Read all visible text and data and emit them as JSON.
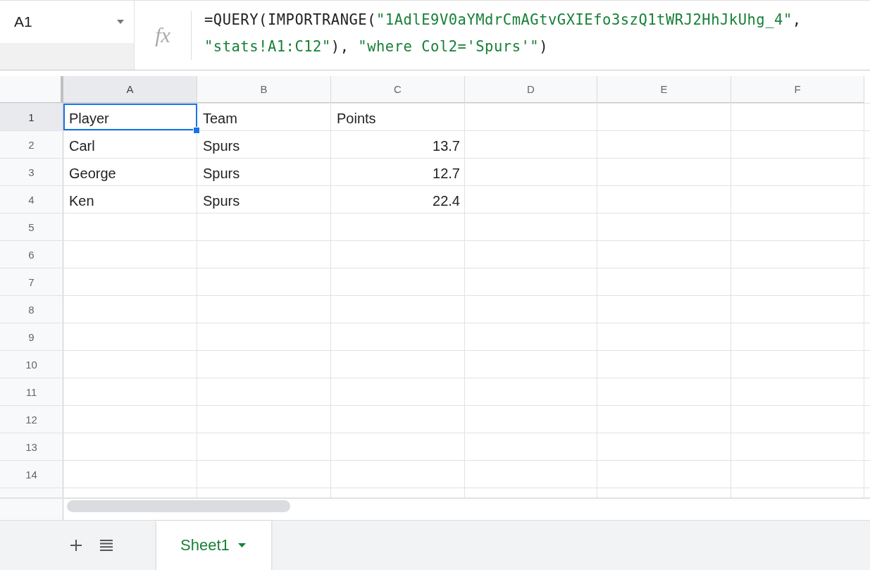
{
  "name_box": {
    "value": "A1"
  },
  "fx_label": "fx",
  "formula": {
    "lines": [
      [
        {
          "kind": "plain",
          "text": "=QUERY(IMPORTRANGE("
        },
        {
          "kind": "string",
          "text": "\"1AdlE9V0aYMdrCmAGtvGXIEfo3szQ1tWRJ2HhJkUhg_4\""
        },
        {
          "kind": "plain",
          "text": ","
        }
      ],
      [
        {
          "kind": "string",
          "text": "\"stats!A1:C12\""
        },
        {
          "kind": "plain",
          "text": "), "
        },
        {
          "kind": "string",
          "text": "\"where Col2='Spurs'\""
        },
        {
          "kind": "plain",
          "text": ")"
        }
      ]
    ]
  },
  "columns": [
    {
      "label": "A",
      "selected": true
    },
    {
      "label": "B",
      "selected": false
    },
    {
      "label": "C",
      "selected": false
    },
    {
      "label": "D",
      "selected": false
    },
    {
      "label": "E",
      "selected": false
    },
    {
      "label": "F",
      "selected": false
    }
  ],
  "rows": [
    {
      "number": "1",
      "selected": true,
      "cells": [
        {
          "text": "Player",
          "kind": "text",
          "selected": true
        },
        {
          "text": "Team",
          "kind": "text",
          "selected": false
        },
        {
          "text": "Points",
          "kind": "text",
          "selected": false
        }
      ]
    },
    {
      "number": "2",
      "selected": false,
      "cells": [
        {
          "text": "Carl",
          "kind": "text",
          "selected": false
        },
        {
          "text": "Spurs",
          "kind": "text",
          "selected": false
        },
        {
          "text": "13.7",
          "kind": "number",
          "selected": false
        }
      ]
    },
    {
      "number": "3",
      "selected": false,
      "cells": [
        {
          "text": "George",
          "kind": "text",
          "selected": false
        },
        {
          "text": "Spurs",
          "kind": "text",
          "selected": false
        },
        {
          "text": "12.7",
          "kind": "number",
          "selected": false
        }
      ]
    },
    {
      "number": "4",
      "selected": false,
      "cells": [
        {
          "text": "Ken",
          "kind": "text",
          "selected": false
        },
        {
          "text": "Spurs",
          "kind": "text",
          "selected": false
        },
        {
          "text": "22.4",
          "kind": "number",
          "selected": false
        }
      ]
    },
    {
      "number": "5",
      "selected": false,
      "cells": []
    },
    {
      "number": "6",
      "selected": false,
      "cells": []
    },
    {
      "number": "7",
      "selected": false,
      "cells": []
    },
    {
      "number": "8",
      "selected": false,
      "cells": []
    },
    {
      "number": "9",
      "selected": false,
      "cells": []
    },
    {
      "number": "10",
      "selected": false,
      "cells": []
    },
    {
      "number": "11",
      "selected": false,
      "cells": []
    },
    {
      "number": "12",
      "selected": false,
      "cells": []
    },
    {
      "number": "13",
      "selected": false,
      "cells": []
    },
    {
      "number": "14",
      "selected": false,
      "cells": []
    }
  ],
  "sheet_tabs": [
    {
      "label": "Sheet1",
      "selected": true
    }
  ]
}
